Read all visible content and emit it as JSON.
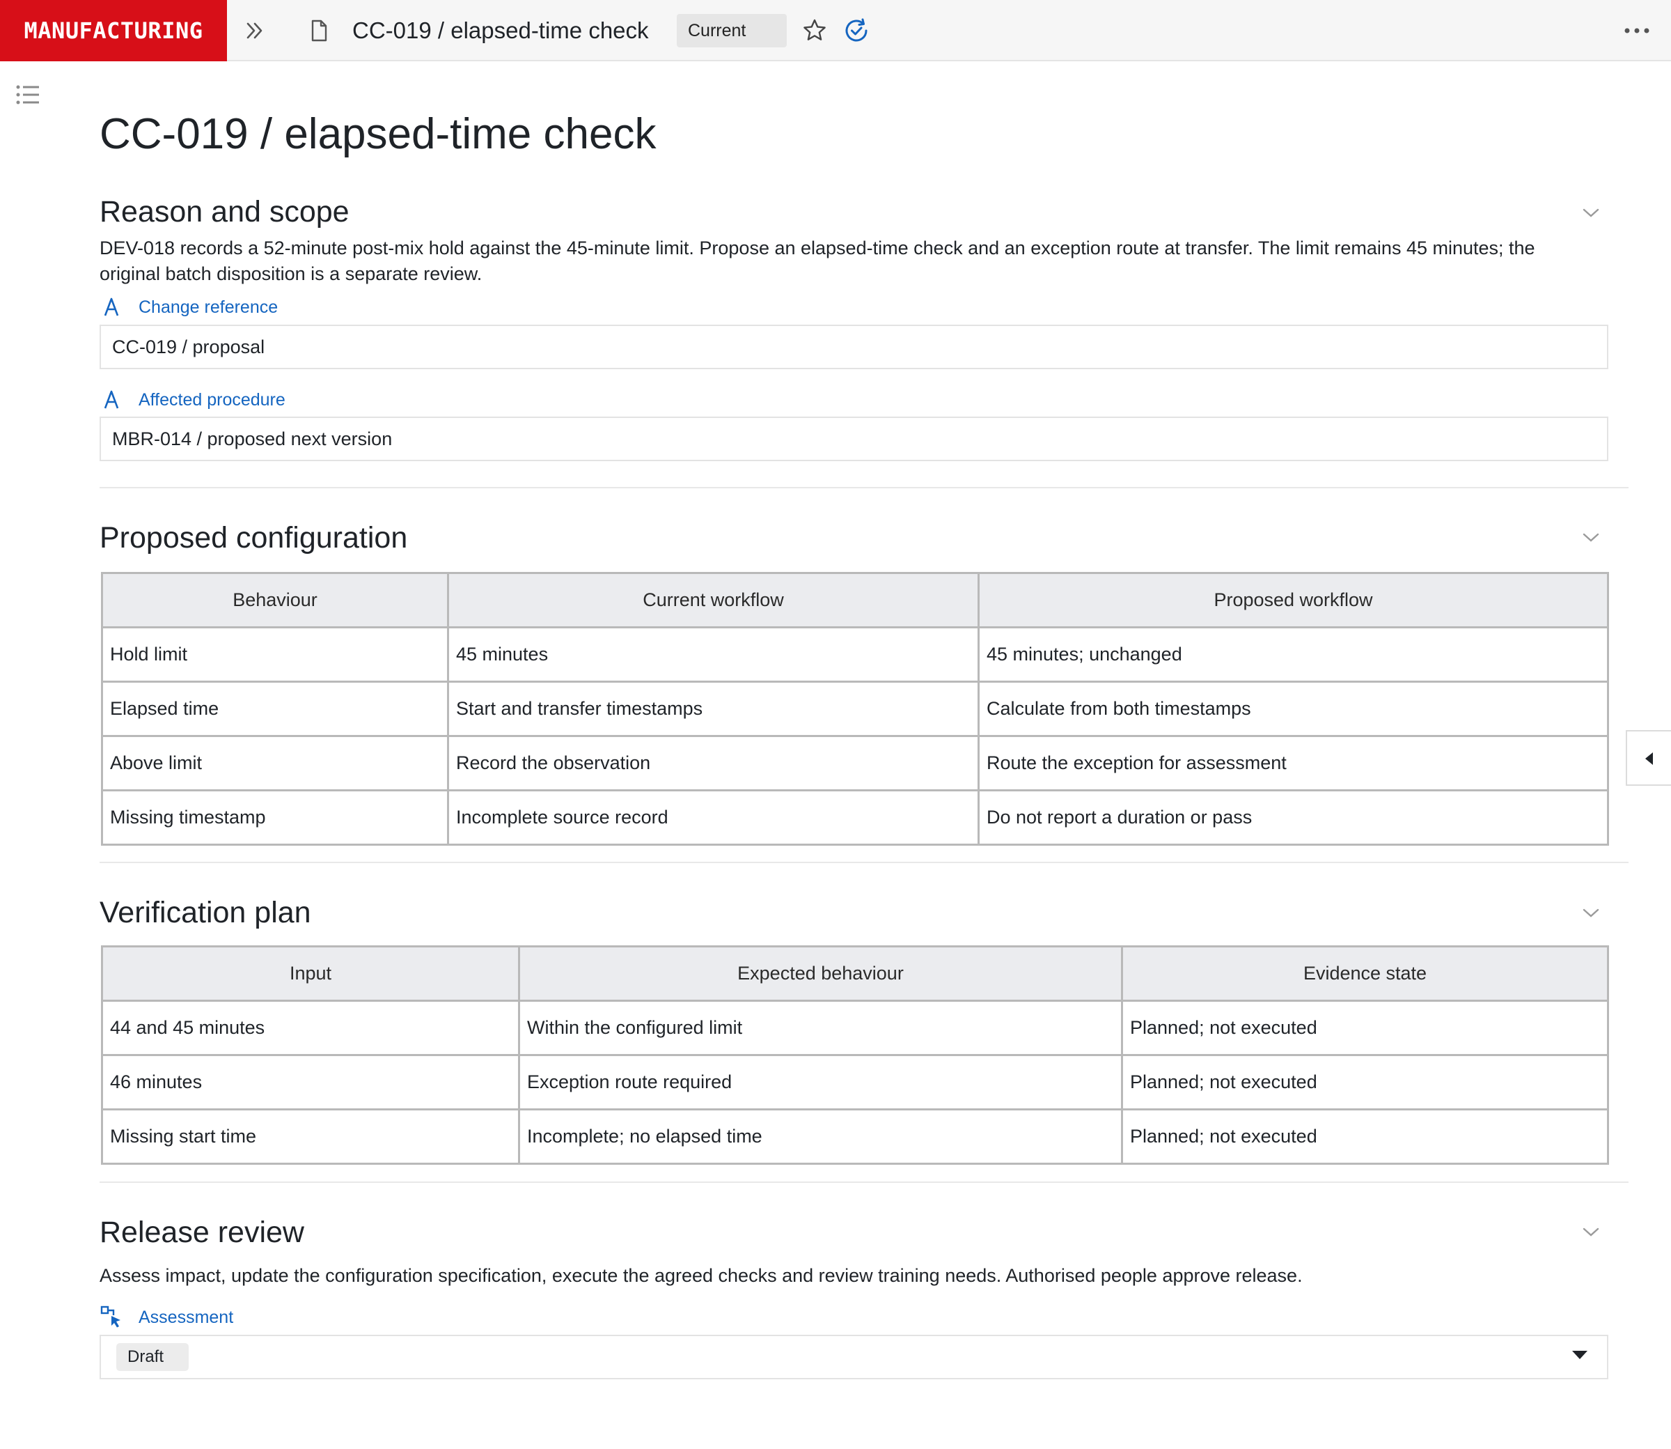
{
  "topbar": {
    "brand": "MANUFACTURING",
    "doc_title": "CC-019 / elapsed-time check",
    "status": "Current"
  },
  "page": {
    "title": "CC-019 / elapsed-time check"
  },
  "reason": {
    "heading": "Reason and scope",
    "body": "DEV-018 records a 52-minute post-mix hold against the 45-minute limit. Propose an elapsed-time check and an exception route at transfer. The limit remains 45 minutes; the original batch disposition is a separate review.",
    "fields": [
      {
        "label": "Change reference",
        "value": "CC-019 / proposal"
      },
      {
        "label": "Affected procedure",
        "value": "MBR-014 / proposed next version"
      }
    ]
  },
  "config": {
    "heading": "Proposed configuration",
    "columns": [
      "Behaviour",
      "Current workflow",
      "Proposed workflow"
    ],
    "rows": [
      [
        "Hold limit",
        "45 minutes",
        "45 minutes; unchanged"
      ],
      [
        "Elapsed time",
        "Start and transfer timestamps",
        "Calculate from both timestamps"
      ],
      [
        "Above limit",
        "Record the observation",
        "Route the exception for assessment"
      ],
      [
        "Missing timestamp",
        "Incomplete source record",
        "Do not report a duration or pass"
      ]
    ]
  },
  "verification": {
    "heading": "Verification plan",
    "columns": [
      "Input",
      "Expected behaviour",
      "Evidence state"
    ],
    "rows": [
      [
        "44 and 45 minutes",
        "Within the configured limit",
        "Planned; not executed"
      ],
      [
        "46 minutes",
        "Exception route required",
        "Planned; not executed"
      ],
      [
        "Missing start time",
        "Incomplete; no elapsed time",
        "Planned; not executed"
      ]
    ]
  },
  "release": {
    "heading": "Release review",
    "body": "Assess impact, update the configuration specification, execute the agreed checks and review training needs. Authorised people approve release.",
    "field_label": "Assessment",
    "field_value": "Draft"
  },
  "icons": {
    "expand": "double-chevron-right-icon",
    "document": "document-icon",
    "favorite": "star-icon",
    "status": "check-circle-icon",
    "more": "more-horizontal-icon",
    "toc": "list-icon",
    "text_field": "text-field-icon",
    "select_field": "select-field-icon"
  },
  "colors": {
    "brand": "#d70f18",
    "accent": "#1565c0"
  }
}
